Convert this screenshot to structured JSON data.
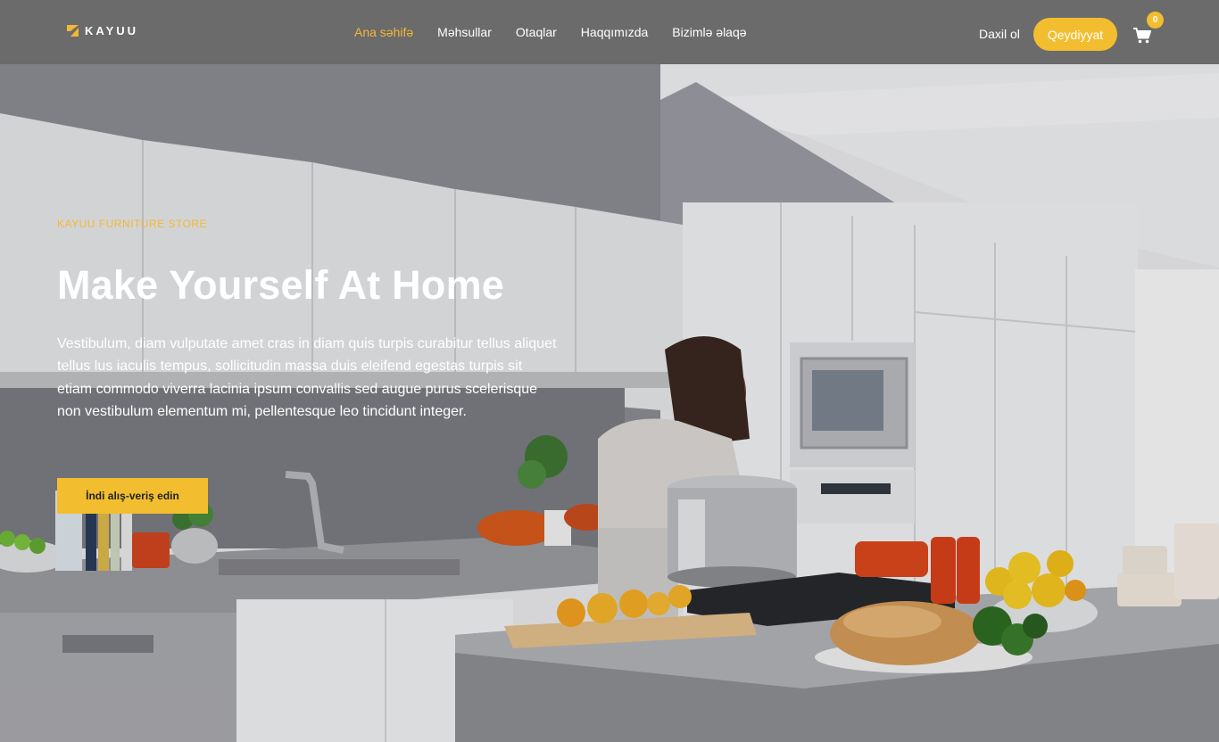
{
  "header": {
    "logo_text": "KAYUU",
    "nav": [
      "Ana səhifə",
      "Məhsullar",
      "Otaqlar",
      "Haqqımızda",
      "Bizimlə əlaqə"
    ],
    "login_label": "Daxil ol",
    "register_label": "Qeydiyyat",
    "cart_count": "0"
  },
  "hero": {
    "eyebrow": "KAYUU FURNITURE STORE",
    "title": "Make Yourself At Home",
    "description": "Vestibulum, diam vulputate amet cras in diam quis turpis curabitur tellus aliquet tellus lus iaculis tempus, sollicitudin massa duis eleifend egestas turpis sit etiam commodo viverra lacinia ipsum convallis sed augue purus scelerisque non vestibulum elementum mi, pellentesque leo tincidunt integer.",
    "cta_label": "İndi alış-veriş edin"
  },
  "colors": {
    "accent": "#f2be2f",
    "header_bg": "#6b6b6b"
  },
  "icons": {
    "logo": "kayuu-logo-icon",
    "cart": "shopping-cart-icon"
  }
}
